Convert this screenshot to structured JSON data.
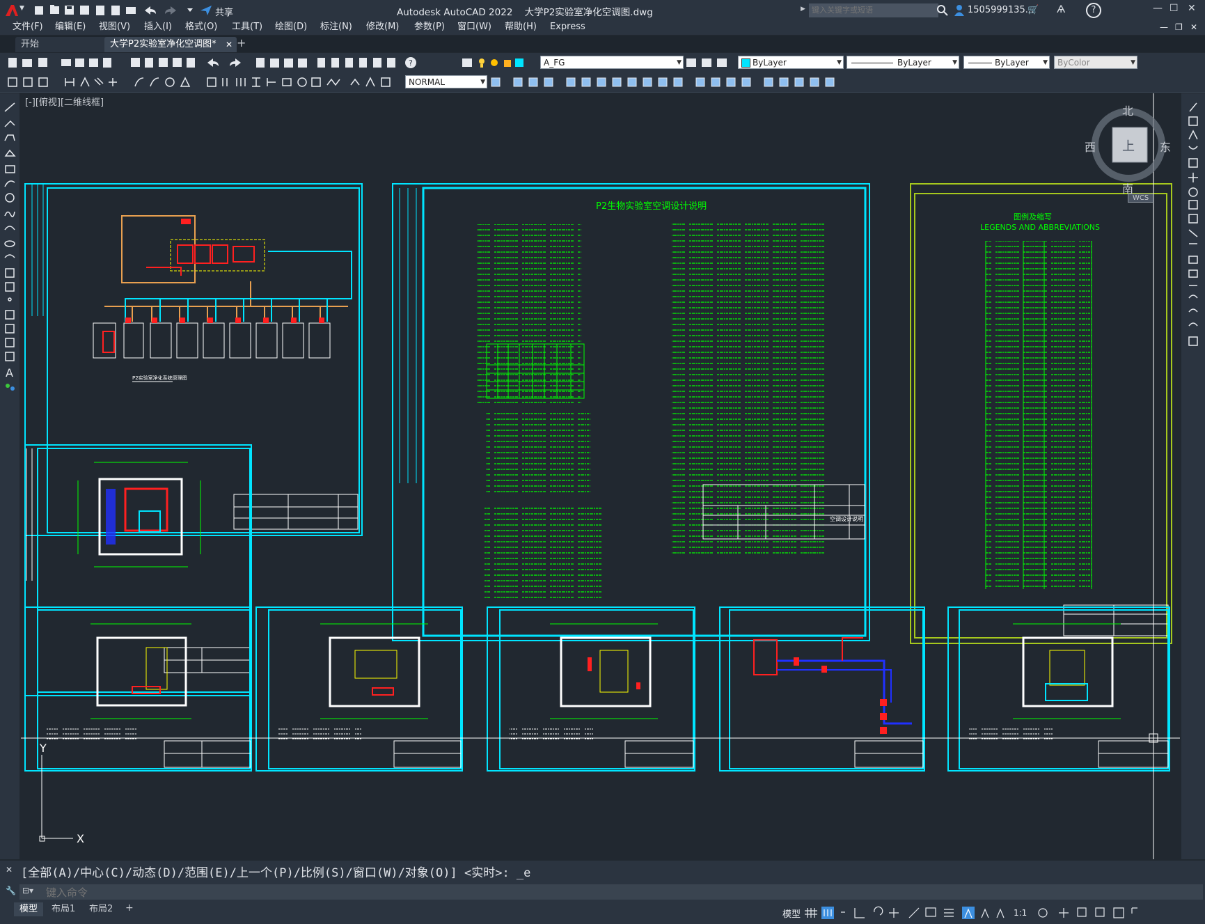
{
  "window": {
    "title": "Autodesk AutoCAD 2022    大学P2实验室净化空调图.dwg",
    "share_label": "共享",
    "search_placeholder": "键入关键字或短语",
    "user_label": "1505999135...",
    "controls": [
      "—",
      "☐",
      "✕"
    ]
  },
  "menu": {
    "items": [
      "文件(F)",
      "编辑(E)",
      "视图(V)",
      "插入(I)",
      "格式(O)",
      "工具(T)",
      "绘图(D)",
      "标注(N)",
      "修改(M)",
      "参数(P)",
      "窗口(W)",
      "帮助(H)",
      "Express"
    ]
  },
  "tabs": {
    "items": [
      "开始",
      "大学P2实验室净化空调图*"
    ],
    "active": 1,
    "add": "+"
  },
  "properties": {
    "layer": "A_FG",
    "color": "ByLayer",
    "linetype": "ByLayer",
    "lineweight": "ByLayer",
    "plotstyle": "ByColor",
    "textstyle": "NORMAL"
  },
  "viewport": {
    "label": "[-][俯视][二维线框]",
    "viewcube": {
      "north": "北",
      "south": "南",
      "east": "东",
      "west": "西",
      "top": "上",
      "wcs": "WCS"
    },
    "ucs": {
      "x": "X",
      "y": "Y"
    }
  },
  "drawing": {
    "sheet_notes_title": "P2生物实验室空调设计说明",
    "legend_title_cn": "图例及缩写",
    "legend_title_en": "LEGENDS AND ABBREVIATIONS",
    "schematic_title": "P2实验室净化系统原理图",
    "notes_titleblock_label": "空调设计说明"
  },
  "command": {
    "history": "[全部(A)/中心(C)/动态(D)/范围(E)/上一个(P)/比例(S)/窗口(W)/对象(O)] <实时>: _e",
    "placeholder": "键入命令"
  },
  "status": {
    "tabs": [
      "模型",
      "布局1",
      "布局2"
    ],
    "active": 0,
    "add": "+",
    "model_label": "模型",
    "scale": "1:1"
  },
  "colors": {
    "cyan": "#00e5ff",
    "green": "#00ff00",
    "yellow_green": "#a6c81e",
    "red": "#ff2020",
    "orange": "#e8a050",
    "blue": "#2030ff",
    "canvas": "#212830"
  }
}
